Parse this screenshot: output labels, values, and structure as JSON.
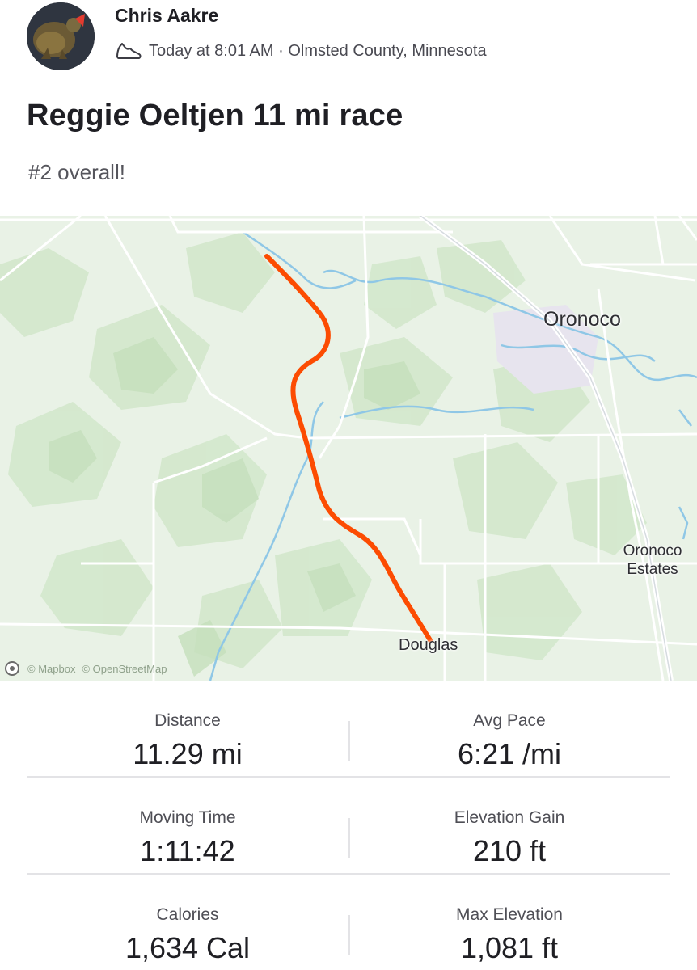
{
  "header": {
    "athlete_name": "Chris Aakre",
    "activity_icon": "shoe-icon",
    "meta": "Today at 8:01 AM · Olmsted County, Minnesota"
  },
  "activity": {
    "title": "Reggie Oeltjen 11 mi race",
    "description": "#2 overall!"
  },
  "map": {
    "route_color": "#fc4c02",
    "labels": {
      "oronoco": "Oronoco",
      "oronoco_estates_line1": "Oronoco",
      "oronoco_estates_line2": "Estates",
      "douglas": "Douglas"
    },
    "attribution": {
      "mapbox": "© Mapbox",
      "osm": "© OpenStreetMap"
    }
  },
  "stats": [
    [
      {
        "label": "Distance",
        "value": "11.29 mi"
      },
      {
        "label": "Avg Pace",
        "value": "6:21 /mi"
      }
    ],
    [
      {
        "label": "Moving Time",
        "value": "1:11:42"
      },
      {
        "label": "Elevation Gain",
        "value": "210 ft"
      }
    ],
    [
      {
        "label": "Calories",
        "value": "1,634 Cal"
      },
      {
        "label": "Max Elevation",
        "value": "1,081 ft"
      }
    ]
  ]
}
